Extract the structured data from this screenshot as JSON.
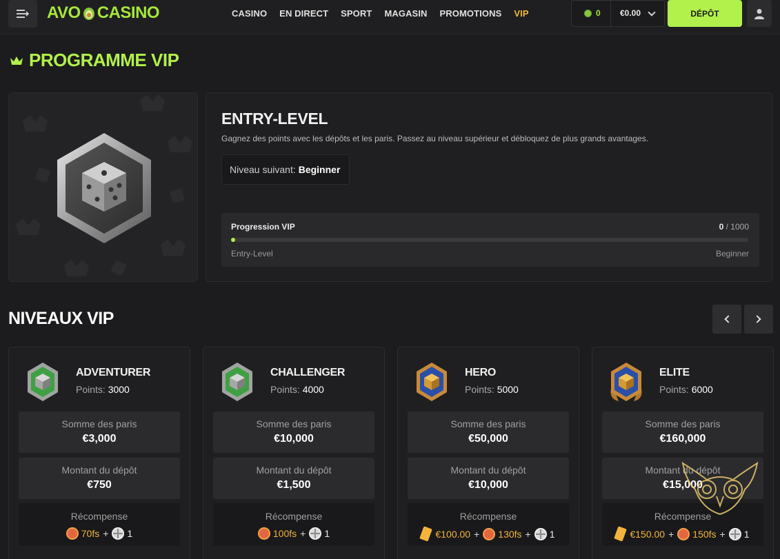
{
  "header": {
    "logo_left": "AVO",
    "logo_right": "CASINO",
    "nav": [
      "CASINO",
      "EN DIRECT",
      "SPORT",
      "MAGASIN",
      "PROMOTIONS",
      "VIP"
    ],
    "coins": "0",
    "balance": "€0.00",
    "deposit_label": "DÉPÔT"
  },
  "vip": {
    "title": "PROGRAMME VIP",
    "current_level": "ENTRY-LEVEL",
    "description": "Gagnez des points avec les dépôts et les paris. Passez au niveau supérieur et débloquez de plus grands avantages.",
    "next_label": "Niveau suivant:",
    "next_value": "Beginner",
    "progress_label": "Progression VIP",
    "progress_current": "0",
    "progress_total": "/ 1000",
    "progress_fraction": 0,
    "progress_start": "Entry-Level",
    "progress_end": "Beginner"
  },
  "levels": {
    "title": "NIVEAUX VIP",
    "points_label": "Points:",
    "bets_label": "Somme des paris",
    "deposit_label": "Montant du dépôt",
    "reward_label": "Récompense",
    "items": [
      {
        "name": "ADVENTURER",
        "points": "3000",
        "bets": "€3,000",
        "deposit": "€750",
        "reward_cash": "",
        "reward_fs": "70fs",
        "reward_wheel": "1",
        "badge": "green"
      },
      {
        "name": "CHALLENGER",
        "points": "4000",
        "bets": "€10,000",
        "deposit": "€1,500",
        "reward_cash": "",
        "reward_fs": "100fs",
        "reward_wheel": "1",
        "badge": "green"
      },
      {
        "name": "HERO",
        "points": "5000",
        "bets": "€50,000",
        "deposit": "€10,000",
        "reward_cash": "€100.00",
        "reward_fs": "130fs",
        "reward_wheel": "1",
        "badge": "blue"
      },
      {
        "name": "ELITE",
        "points": "6000",
        "bets": "€160,000",
        "deposit": "€15,000",
        "reward_cash": "€150.00",
        "reward_fs": "150fs",
        "reward_wheel": "1",
        "badge": "blue-wings"
      }
    ]
  },
  "colors": {
    "accent": "#b2f04b",
    "vip_nav": "#f0b838",
    "reward": "#f2b43c"
  }
}
